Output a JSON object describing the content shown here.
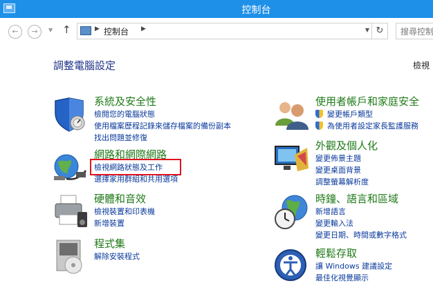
{
  "window": {
    "title": "控制台"
  },
  "nav": {
    "breadcrumb": "控制台",
    "search_placeholder": "搜尋控制"
  },
  "header": {
    "title": "調整電腦設定",
    "view_by": "檢視"
  },
  "categories": [
    {
      "title": "系統及安全性",
      "icon": "shield-icon",
      "links": [
        "檢閱您的電腦狀態",
        "使用檔案歷程記錄來儲存檔案的備份副本",
        "找出問題並修復"
      ]
    },
    {
      "title": "網路和網際網路",
      "icon": "network-icon",
      "links": [
        "檢視網路狀態及工作",
        "選擇家用群組和共用選項"
      ]
    },
    {
      "title": "硬體和音效",
      "icon": "printer-icon",
      "links": [
        "檢視裝置和印表機",
        "新增裝置"
      ]
    },
    {
      "title": "程式集",
      "icon": "programs-icon",
      "links": [
        "解除安裝程式"
      ]
    },
    {
      "title": "使用者帳戶和家庭安全",
      "icon": "users-icon",
      "links": [
        "變更帳戶類型",
        "為使用者設定家長監護服務"
      ]
    },
    {
      "title": "外觀及個人化",
      "icon": "display-icon",
      "links": [
        "變更佈景主題",
        "變更桌面背景",
        "調整螢幕解析度"
      ]
    },
    {
      "title": "時鐘、語言和區域",
      "icon": "clock-globe-icon",
      "links": [
        "新增語言",
        "變更輸入法",
        "變更日期、時間或數字格式"
      ]
    },
    {
      "title": "輕鬆存取",
      "icon": "ease-of-access-icon",
      "links": [
        "讓 Windows 建議設定",
        "最佳化視覺顯示"
      ]
    }
  ],
  "colors": {
    "titlebar": "#1e90e8",
    "category_title": "#1f7a18",
    "link": "#0a3a9c",
    "highlight": "#e0141e"
  }
}
